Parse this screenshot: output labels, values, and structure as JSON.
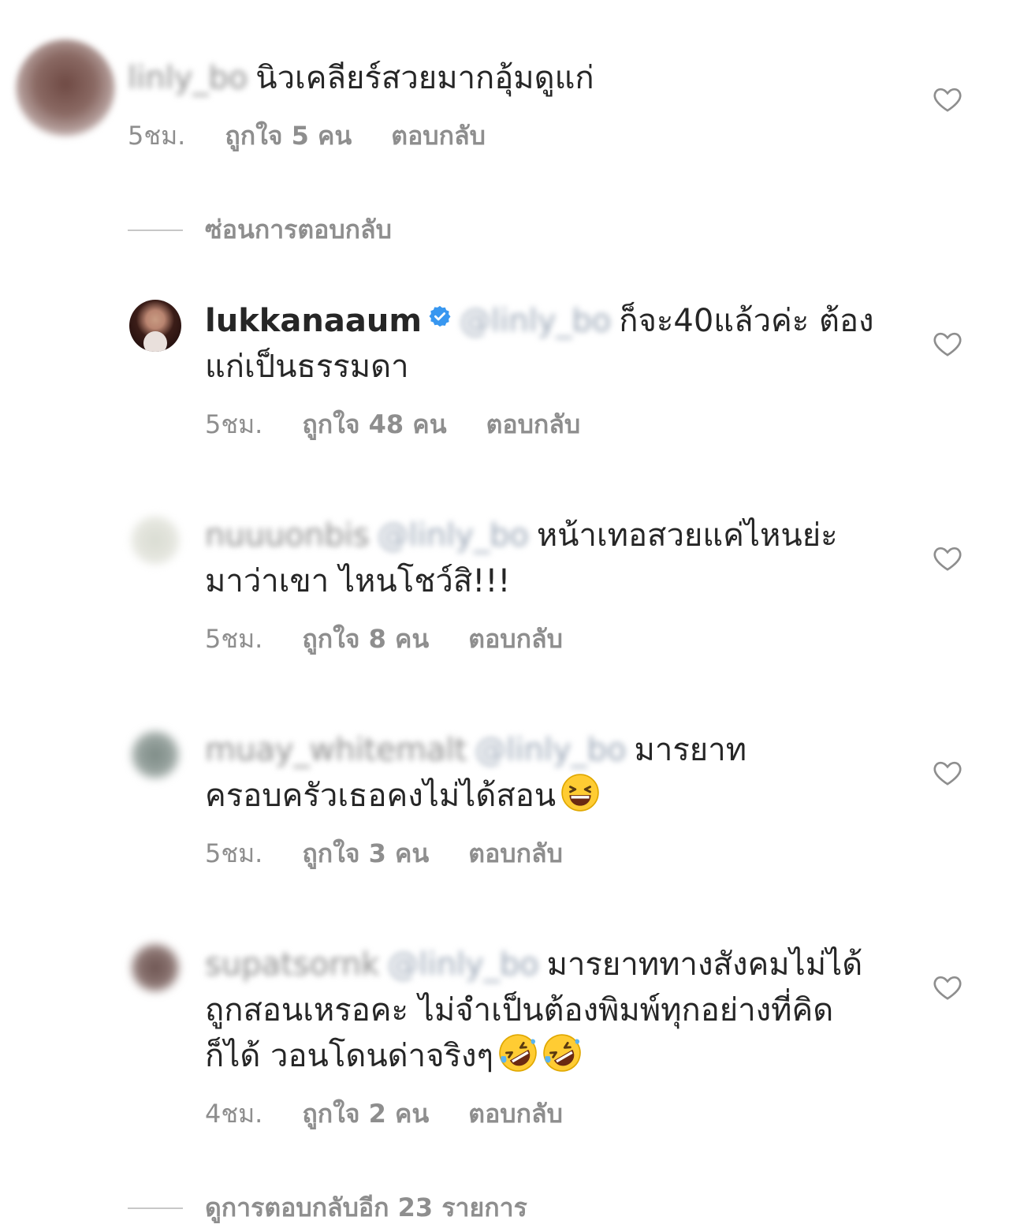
{
  "top_comment": {
    "username": "linly_bo",
    "text": "นิวเคลียร์สวยมากอุ้มดูแก่",
    "time": "5ชม.",
    "likes": "ถูกใจ 5 คน",
    "reply": "ตอบกลับ"
  },
  "hide_replies": "ซ่อนการตอบกลับ",
  "replies": [
    {
      "username": "lukkanaaum",
      "mention": "@linly_bo",
      "text": "ก็จะ40แล้วค่ะ ต้องแก่เป็นธรรมดา",
      "time": "5ชม.",
      "likes": "ถูกใจ 48 คน",
      "reply": "ตอบกลับ"
    },
    {
      "username": "nuuuonbis",
      "mention": "@linly_bo",
      "text": "หน้าเทอสวยแค่ไหนย่ะ มาว่าเขา ไหนโชว์สิ!!!",
      "time": "5ชม.",
      "likes": "ถูกใจ 8 คน",
      "reply": "ตอบกลับ"
    },
    {
      "username": "muay_whitemalt",
      "mention": "@linly_bo",
      "text": "มารยาท ครอบครัวเธอคงไม่ได้สอน",
      "time": "5ชม.",
      "likes": "ถูกใจ 3 คน",
      "reply": "ตอบกลับ"
    },
    {
      "username": "supatsornk",
      "mention": "@linly_bo",
      "text": "มารยาททางสังคมไม่ได้ถูกสอนเหรอคะ ไม่จำเป็นต้องพิมพ์ทุกอย่างที่คิดก็ได้ วอนโดนด่าจริงๆ",
      "time": "4ชม.",
      "likes": "ถูกใจ 2 คน",
      "reply": "ตอบกลับ"
    }
  ],
  "view_more_replies": "ดูการตอบกลับอีก 23 รายการ",
  "icons": {
    "like": "heart-outline-icon",
    "verified": "verified-badge-icon",
    "emoji_grin": "grinning-squinting-face-icon",
    "emoji_rofl": "rolling-on-floor-laughing-icon"
  },
  "colors": {
    "text": "#262626",
    "meta": "#8e8e8e",
    "verified": "#3897f0",
    "divider": "#c7c7c7"
  }
}
